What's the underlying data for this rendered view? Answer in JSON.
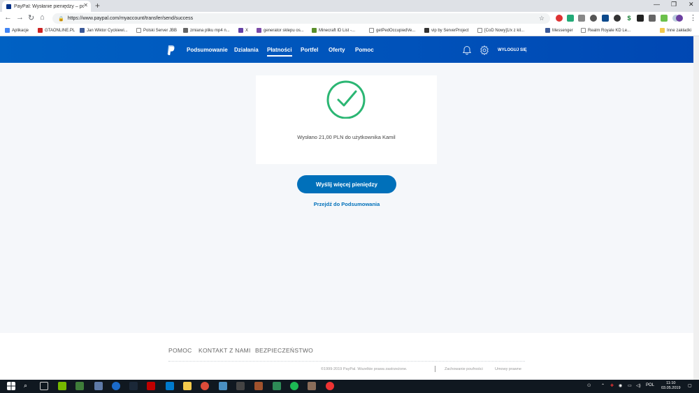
{
  "browser": {
    "tab_title": "PayPal: Wysłanie pieniędzy – pot",
    "url": "https://www.paypal.com/myaccount/transfer/send/success",
    "bookmarks": [
      "Aplikacje",
      "GTAONLINE.PL",
      "Jan Wiktor Cyckiewi...",
      "Polski Server JBB",
      "zmiana pliku mp4 n...",
      "X",
      "generator sklepu os...",
      "Minecraft ID List -...",
      "getPedOccupiedVe...",
      "vip by ServerProject",
      "[CoD Nowy]1/x z kil...",
      "Messenger",
      "Realm Royale KD Le..."
    ],
    "other_bookmarks": "Inne zakładki"
  },
  "header": {
    "nav": [
      "Podsumowanie",
      "Działania",
      "Płatności",
      "Portfel",
      "Oferty",
      "Pomoc"
    ],
    "logout": "WYLOGUJ SIĘ"
  },
  "main": {
    "message": "Wysłano 21,00 PLN do użytkownika Kamil",
    "send_more": "Wyślij więcej pieniędzy",
    "go_summary": "Przejdź do Podsumowania"
  },
  "footer": {
    "links": [
      "POMOC",
      "KONTAKT Z NAMI",
      "BEZPIECZEŃSTWO"
    ],
    "copyright": "©1999-2019 PayPal. Wszelkie prawa zastrzeżone.",
    "privacy": "Zachowanie poufności",
    "terms": "Umowy prawne"
  },
  "taskbar": {
    "lang": "POL",
    "time": "11:10",
    "date": "03.05.2019"
  },
  "colors": {
    "header": "#0061c3",
    "accent": "#0070ba",
    "success": "#2bb673"
  }
}
